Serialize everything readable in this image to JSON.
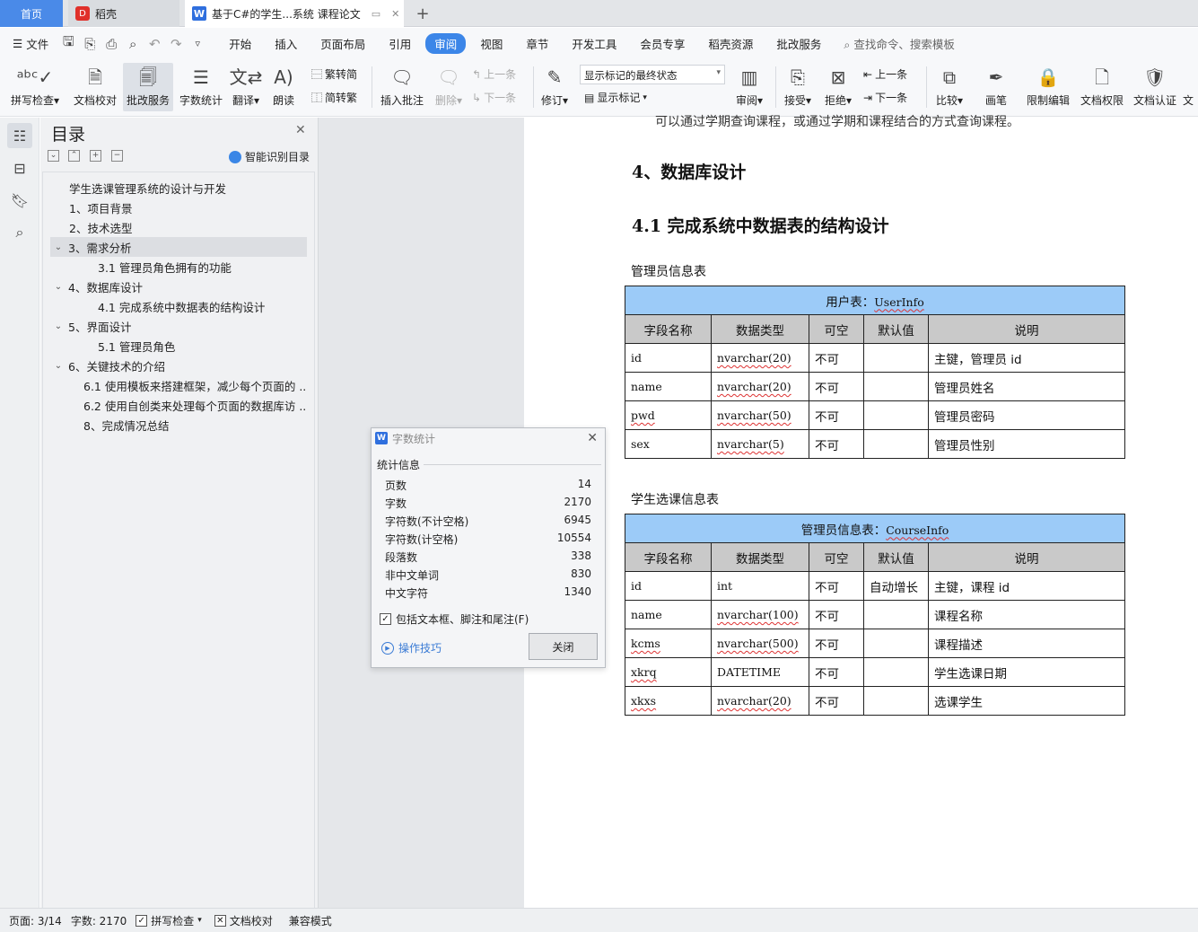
{
  "tabs": {
    "home": "首页",
    "daoke": "稻壳",
    "doc": "基于C#的学生...系统 课程论文",
    "plus": "+"
  },
  "menu": {
    "file": "文件",
    "tabs": [
      "开始",
      "插入",
      "页面布局",
      "引用",
      "审阅",
      "视图",
      "章节",
      "开发工具",
      "会员专享",
      "稻壳资源",
      "批改服务"
    ],
    "active": "审阅",
    "search": "查找命令、搜索模板"
  },
  "ribbon": {
    "spell": "拼写检查",
    "proof": "文档校对",
    "review_service": "批改服务",
    "wordcount": "字数统计",
    "translate": "翻译",
    "read": "朗读",
    "trad": "繁转简",
    "simp": "简转繁",
    "insert_comment": "插入批注",
    "delete": "删除",
    "prev": "上一条",
    "next": "下一条",
    "revise": "修订",
    "markup_state": "显示标记的最终状态",
    "show_markup": "显示标记",
    "review": "审阅",
    "accept": "接受",
    "reject": "拒绝",
    "prev2": "上一条",
    "next2": "下一条",
    "compare": "比较",
    "pen": "画笔",
    "restrict": "限制编辑",
    "permission": "文档权限",
    "certify": "文档认证",
    "cut": "文"
  },
  "toc": {
    "title": "目录",
    "smart": "智能识别目录",
    "items": [
      "学生选课管理系统的设计与开发",
      "1、项目背景",
      "2、技术选型",
      "3、需求分析",
      "3.1 管理员角色拥有的功能",
      "4、数据库设计",
      "4.1 完成系统中数据表的结构设计",
      "5、界面设计",
      "5.1 管理员角色",
      "6、关键技术的介绍",
      "6.1 使用模板来搭建框架，减少每个页面的 ...",
      "6.2 使用自创类来处理每个页面的数据库访 ...",
      "8、完成情况总结"
    ]
  },
  "doc": {
    "cut_line": "可以通过学期查询课程，或通过学期和课程结合的方式查询课程。",
    "h_db": "4、数据库设计",
    "h_struct": "4.1 完成系统中数据表的结构设计",
    "cap1": "管理员信息表",
    "cap2": "学生选课信息表",
    "table1": {
      "title": "用户表：",
      "title_code": "UserInfo",
      "cols": [
        "字段名称",
        "数据类型",
        "可空",
        "默认值",
        "说明"
      ],
      "rows": [
        [
          "id",
          "nvarchar(20)",
          "不可",
          "",
          "主键，管理员 id"
        ],
        [
          "name",
          "nvarchar(20)",
          "不可",
          "",
          "管理员姓名"
        ],
        [
          "pwd",
          "nvarchar(50)",
          "不可",
          "",
          "管理员密码"
        ],
        [
          "sex",
          "nvarchar(5)",
          "不可",
          "",
          "管理员性别"
        ]
      ]
    },
    "table2": {
      "title": "管理员信息表：",
      "title_code": "CourseInfo",
      "cols": [
        "字段名称",
        "数据类型",
        "可空",
        "默认值",
        "说明"
      ],
      "rows": [
        [
          "id",
          "int",
          "不可",
          "自动增长",
          "主键，课程 id"
        ],
        [
          "name",
          "nvarchar(100)",
          "不可",
          "",
          "课程名称"
        ],
        [
          "kcms",
          "nvarchar(500)",
          "不可",
          "",
          "课程描述"
        ],
        [
          "xkrq",
          "DATETIME",
          "不可",
          "",
          "学生选课日期"
        ],
        [
          "xkxs",
          "nvarchar(20)",
          "不可",
          "",
          "选课学生"
        ]
      ]
    }
  },
  "dialog": {
    "title": "字数统计",
    "section": "统计信息",
    "stats": [
      {
        "label": "页数",
        "value": "14"
      },
      {
        "label": "字数",
        "value": "2170"
      },
      {
        "label": "字符数(不计空格)",
        "value": "6945"
      },
      {
        "label": "字符数(计空格)",
        "value": "10554"
      },
      {
        "label": "段落数",
        "value": "338"
      },
      {
        "label": "非中文单词",
        "value": "830"
      },
      {
        "label": "中文字符",
        "value": "1340"
      }
    ],
    "include": "包括文本框、脚注和尾注(F)",
    "tips": "操作技巧",
    "close": "关闭"
  },
  "status": {
    "page": "页面: 3/14",
    "words": "字数: 2170",
    "spell": "拼写检查",
    "proof": "文档校对",
    "compat": "兼容模式"
  },
  "colors": {
    "accent": "#3c86e8",
    "table_header": "#9ccbf8",
    "col_header": "#c9c9c9"
  }
}
